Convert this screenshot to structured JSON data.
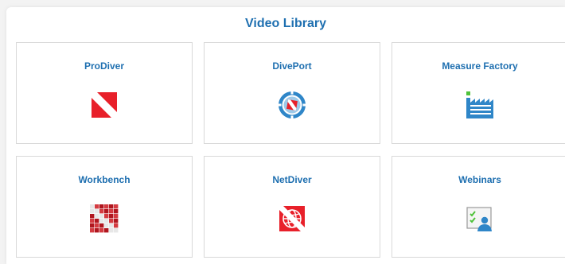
{
  "page": {
    "title": "Video Library"
  },
  "cards": [
    {
      "label": "ProDiver",
      "icon": "prodiver-icon"
    },
    {
      "label": "DivePort",
      "icon": "diveport-compass-icon"
    },
    {
      "label": "Measure Factory",
      "icon": "measure-factory-icon"
    },
    {
      "label": "Workbench",
      "icon": "workbench-grid-icon"
    },
    {
      "label": "NetDiver",
      "icon": "netdiver-globe-icon"
    },
    {
      "label": "Webinars",
      "icon": "webinars-presenter-icon"
    }
  ],
  "colors": {
    "accent": "#1e6fb0",
    "brand_red": "#e8202a",
    "icon_blue": "#2f86c8"
  }
}
